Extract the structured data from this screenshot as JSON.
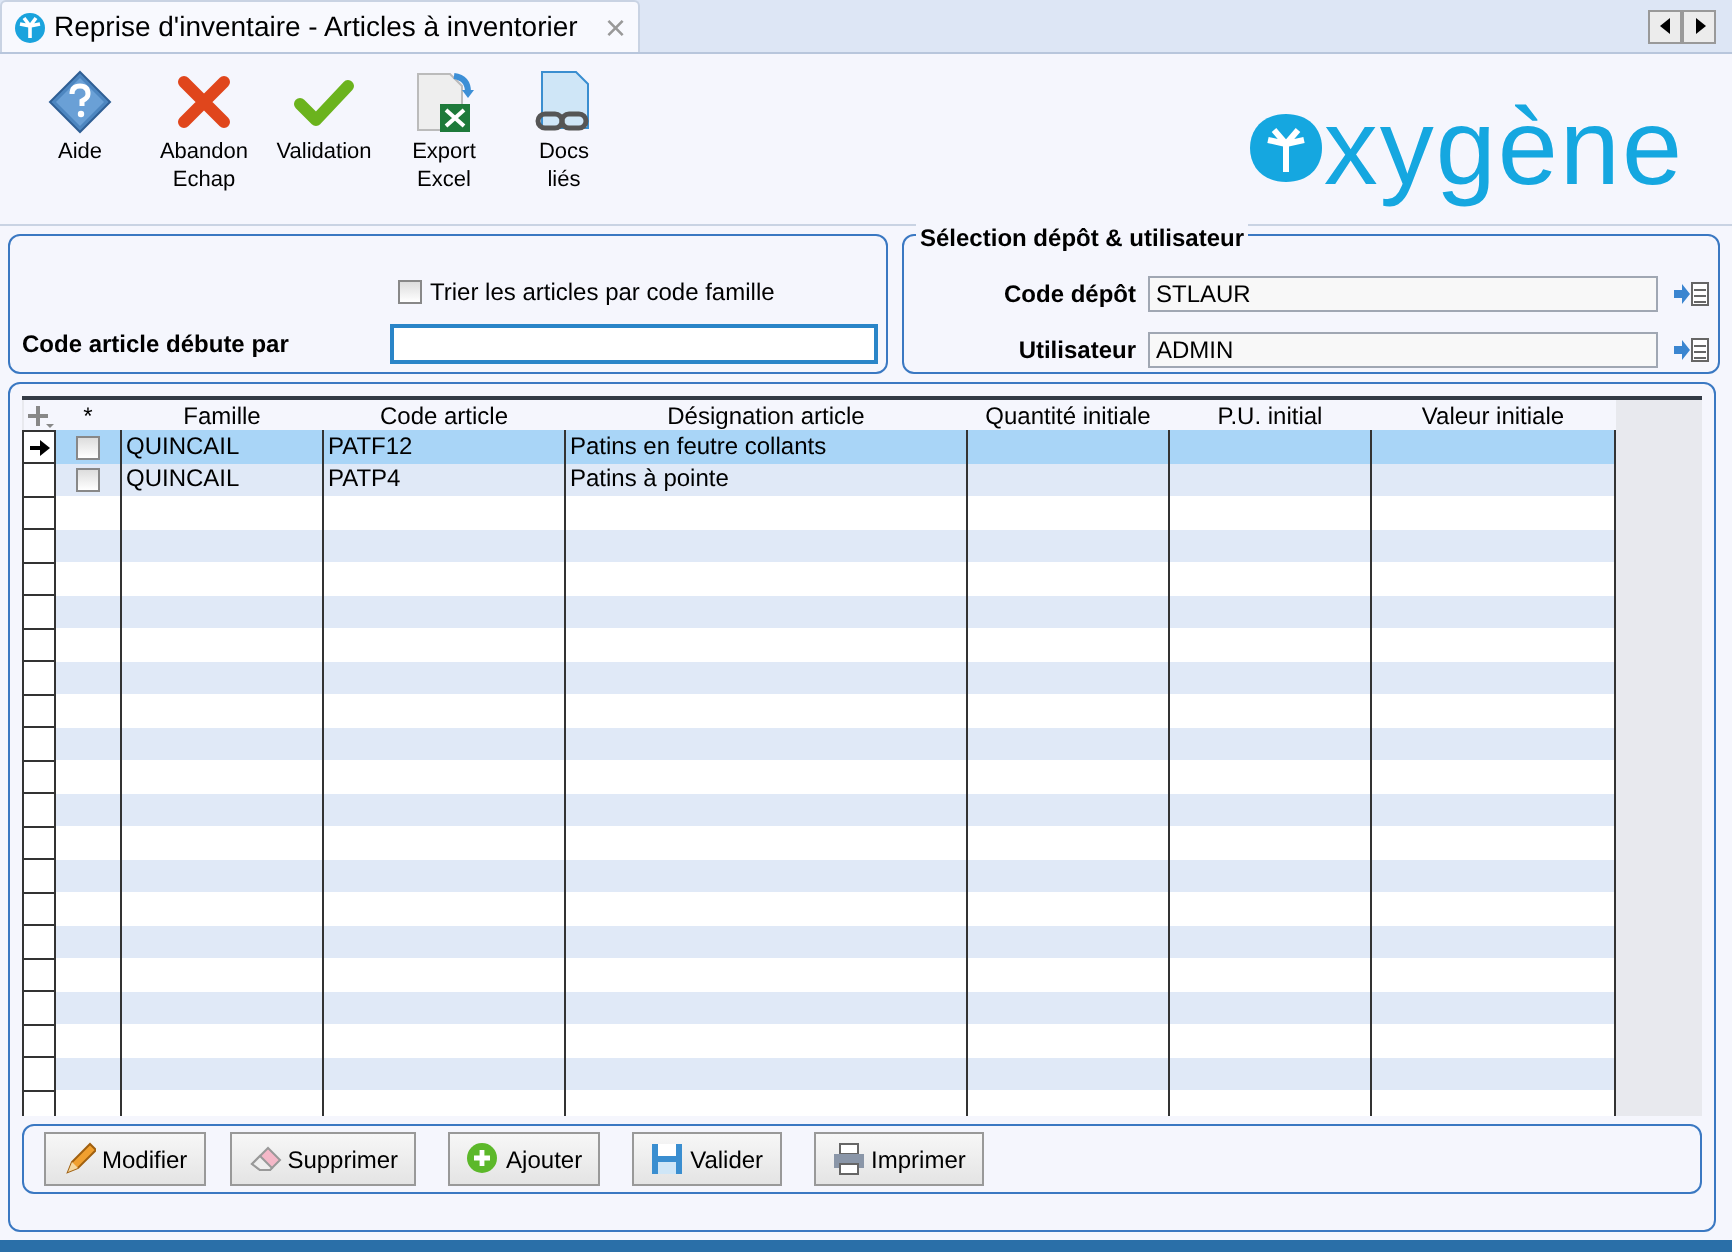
{
  "window": {
    "title": "Reprise d'inventaire - Articles à inventorier",
    "close": "×"
  },
  "toolbar": [
    {
      "kind": "help",
      "label": "Aide"
    },
    {
      "kind": "cancel",
      "label": "Abandon\nEchap"
    },
    {
      "kind": "ok",
      "label": "Validation"
    },
    {
      "kind": "excel",
      "label": "Export\nExcel"
    },
    {
      "kind": "docs",
      "label": "Docs\nliés"
    }
  ],
  "logo": {
    "text": "xygène"
  },
  "filter": {
    "sort_checkbox": {
      "label": "Trier les articles par code famille",
      "checked": false
    },
    "code_label": "Code article débute par"
  },
  "selection": {
    "title": "Sélection dépôt & utilisateur",
    "fields": [
      {
        "label": "Code dépôt",
        "value": "STLAUR"
      },
      {
        "label": "Utilisateur",
        "value": "ADMIN"
      }
    ]
  },
  "table": {
    "check_column": "*",
    "columns": [
      "Famille",
      "Code article",
      "Désignation article",
      "Quantité initiale",
      "P.U. initial",
      "Valeur initiale"
    ],
    "rows": [
      {
        "selected": true,
        "checked": false,
        "cells": [
          "QUINCAIL",
          "PATF12",
          "Patins en feutre collants",
          "",
          "",
          ""
        ]
      },
      {
        "selected": false,
        "checked": false,
        "cells": [
          "QUINCAIL",
          "PATP4",
          "Patins à pointe",
          "",
          "",
          ""
        ]
      }
    ]
  },
  "buttons": [
    {
      "kind": "edit",
      "label": "Modifier"
    },
    {
      "kind": "delete",
      "label": "Supprimer"
    },
    {
      "kind": "add",
      "label": "Ajouter"
    },
    {
      "kind": "save",
      "label": "Valider"
    },
    {
      "kind": "print",
      "label": "Imprimer"
    }
  ]
}
